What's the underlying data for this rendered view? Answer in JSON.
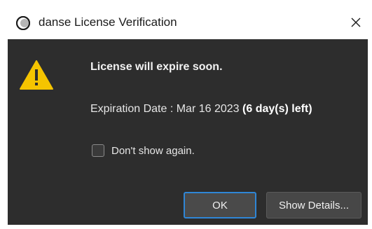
{
  "window": {
    "title": "danse License Verification",
    "app_icon": "app-logo-ring-icon",
    "close_icon": "close-icon"
  },
  "dialog": {
    "icon": "warning-triangle-icon",
    "heading": "License will expire soon.",
    "expiry_label": "Expiration Date : Mar 16 2023 ",
    "expiry_remaining": "(6 day(s) left)",
    "dont_show_label": "Don't show again.",
    "dont_show_checked": false
  },
  "buttons": {
    "ok_label": "OK",
    "details_label": "Show Details..."
  },
  "colors": {
    "dialog_background": "#2d2d2d",
    "warning_yellow": "#f5c400",
    "focus_accent": "#2f86d6"
  }
}
